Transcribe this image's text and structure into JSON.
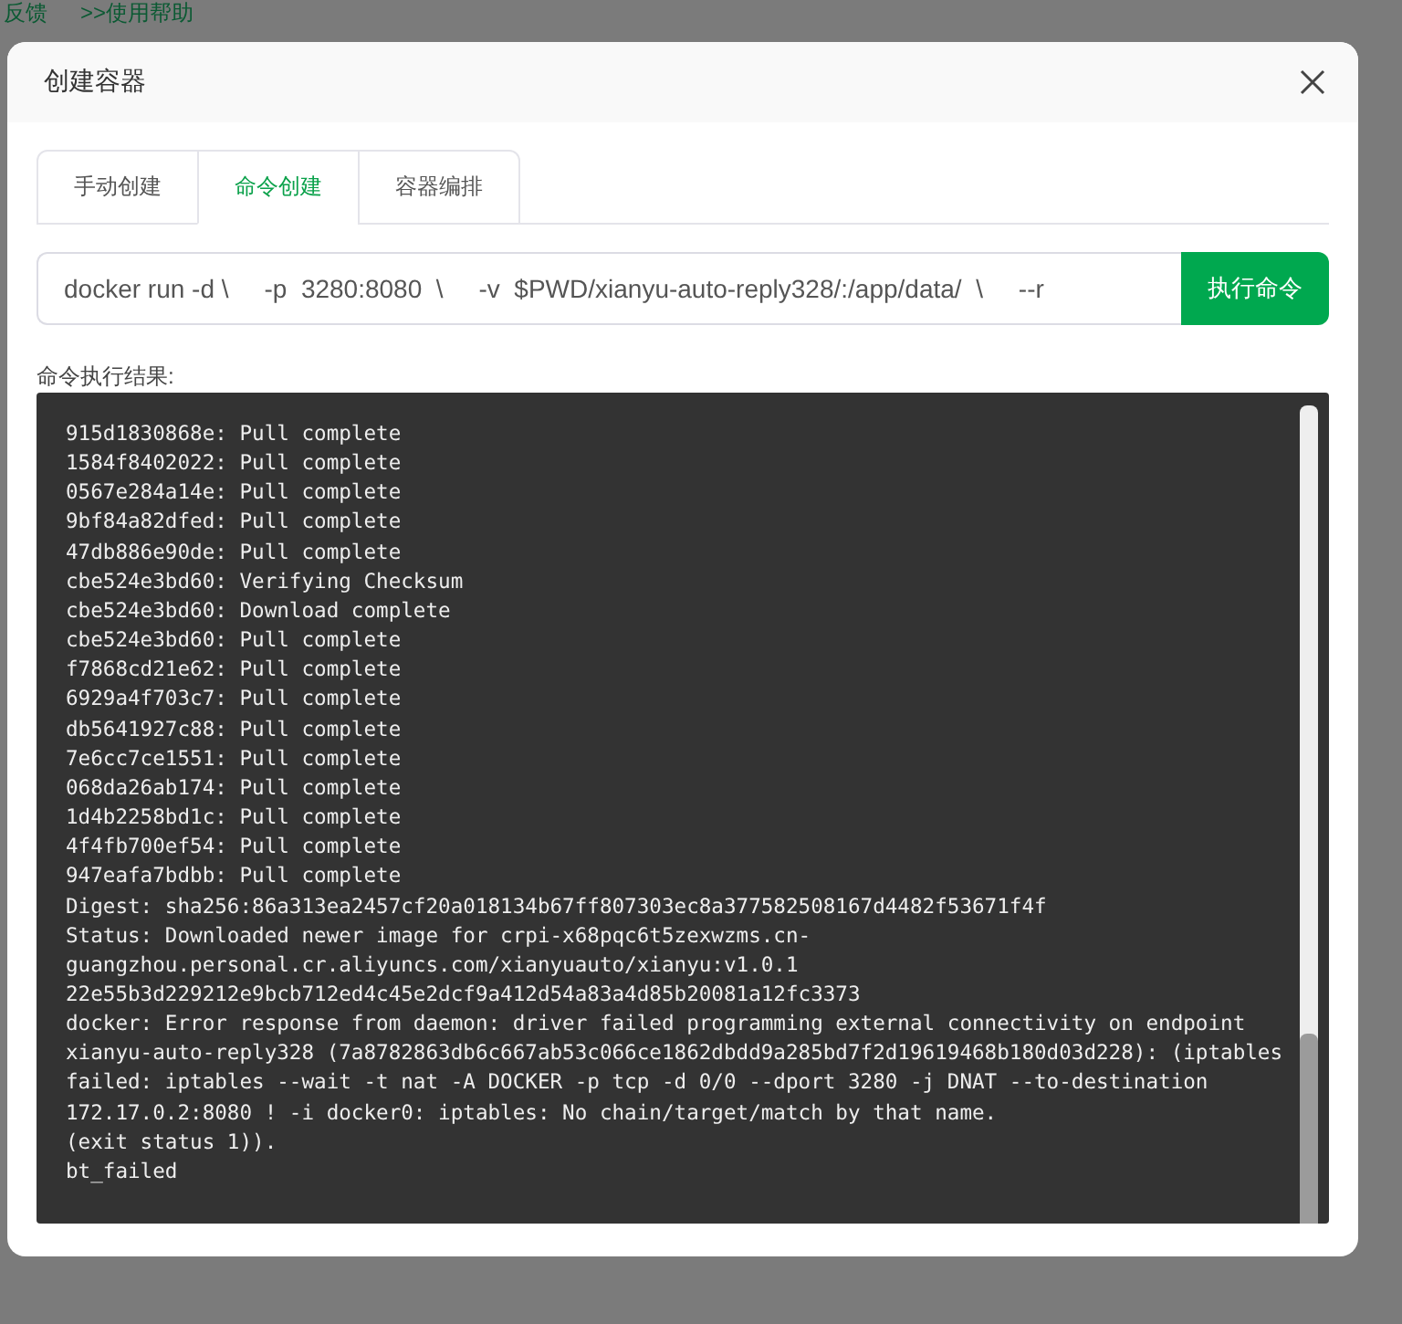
{
  "background_page": {
    "links": [
      "反馈",
      ">>使用帮助"
    ]
  },
  "dialog": {
    "title": "创建容器",
    "tabs": [
      {
        "label": "手动创建",
        "selected": false
      },
      {
        "label": "命令创建",
        "selected": true
      },
      {
        "label": "容器编排",
        "selected": false
      }
    ],
    "command_input": {
      "value": "docker run -d \\     -p  3280:8080  \\     -v  $PWD/xianyu-auto-reply328/:/app/data/  \\     --r"
    },
    "run_button": "执行命令",
    "output_label": "命令执行结果:",
    "output_lines": [
      "915d1830868e: Pull complete",
      "1584f8402022: Pull complete",
      "0567e284a14e: Pull complete",
      "9bf84a82dfed: Pull complete",
      "47db886e90de: Pull complete",
      "cbe524e3bd60: Verifying Checksum",
      "cbe524e3bd60: Download complete",
      "cbe524e3bd60: Pull complete",
      "f7868cd21e62: Pull complete",
      "6929a4f703c7: Pull complete",
      "db5641927c88: Pull complete",
      "7e6cc7ce1551: Pull complete",
      "068da26ab174: Pull complete",
      "1d4b2258bd1c: Pull complete",
      "4f4fb700ef54: Pull complete",
      "947eafa7bdbb: Pull complete",
      "Digest: sha256:86a313ea2457cf20a018134b67ff807303ec8a377582508167d4482f53671f4f",
      "Status: Downloaded newer image for crpi-x68pqc6t5zexwzms.cn-guangzhou.personal.cr.aliyuncs.com/xianyuauto/xianyu:v1.0.1",
      "22e55b3d229212e9bcb712ed4c45e2dcf9a412d54a83a4d85b20081a12fc3373",
      "docker: Error response from daemon: driver failed programming external connectivity on endpoint xianyu-auto-reply328 (7a8782863db6c667ab53c066ce1862dbdd9a285bd7f2d19619468b180d03d228): (iptables failed: iptables --wait -t nat -A DOCKER -p tcp -d 0/0 --dport 3280 -j DNAT --to-destination 172.17.0.2:8080 ! -i docker0: iptables: No chain/target/match by that name.",
      "(exit status 1)).",
      "bt_failed"
    ]
  }
}
